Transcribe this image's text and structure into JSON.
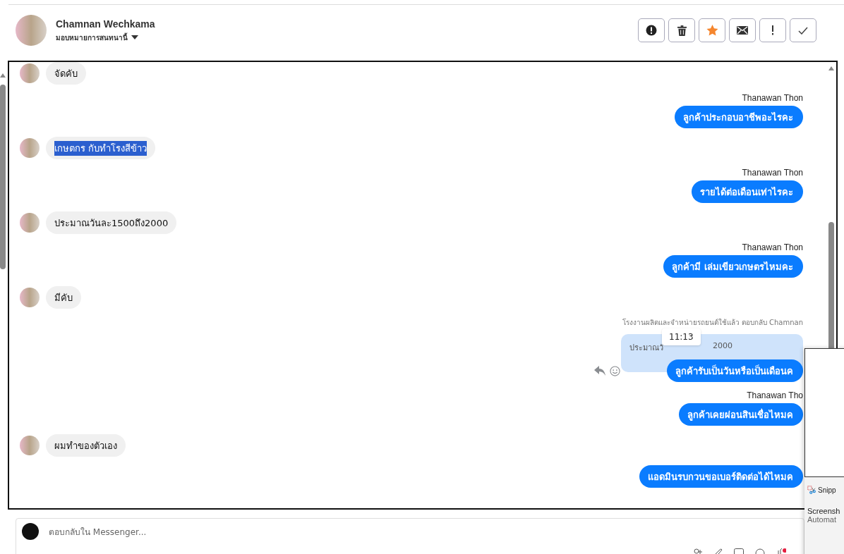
{
  "header": {
    "name": "Chamnan Wechkama",
    "subtitle": "มอบหมายการสนทนานี้",
    "actions": [
      {
        "kind": "alert",
        "active": false
      },
      {
        "kind": "trash",
        "active": false
      },
      {
        "kind": "star",
        "active": true
      },
      {
        "kind": "mail",
        "active": false
      },
      {
        "kind": "exclaim",
        "active": false
      },
      {
        "kind": "check",
        "active": false
      }
    ]
  },
  "messages": [
    {
      "kind": "incoming",
      "text": "จัดคับ",
      "text_selected": false
    },
    {
      "kind": "outgoing",
      "sender": "Thanawan Thon",
      "text": "ลูกค้าประกอบอาชีพอะไรคะ"
    },
    {
      "kind": "incoming",
      "text": "เกษตกร  กับทำโรงสีข้าว",
      "text_selected": true
    },
    {
      "kind": "outgoing",
      "sender": "Thanawan Thon",
      "text": "รายได้ต่อเดือนเท่าไรคะ"
    },
    {
      "kind": "incoming",
      "text": "ประมาณวันละ1500ถึง2000",
      "text_selected": false
    },
    {
      "kind": "outgoing",
      "sender": "Thanawan Thon",
      "text": "ลูกค้ามี  เล่มเขียวเกษตรไหมคะ"
    },
    {
      "kind": "incoming",
      "text": "มีคับ",
      "text_selected": false
    },
    {
      "kind": "reply",
      "reply_label": "โรงงานผลิตและจำหน่ายรถยนต์ใช้แล้ว ตอบกลับ Chamnan",
      "quote_start": "ประมาณวั",
      "quote_end": "2000",
      "tooltip": "11:13",
      "text": "ลูกค้ารับเป็นวันหรือเป็นเดือนค"
    },
    {
      "kind": "outgoing",
      "sender": "Thanawan Tho",
      "text": "ลูกค้าเคยผ่อนสินเชื่อไหมค"
    },
    {
      "kind": "incoming",
      "text": "ผมทำของตัวเอง",
      "text_selected": false
    },
    {
      "kind": "outgoing",
      "text": "แอดมินรบกวนขอเบอร์ติดต่อได้ไหมค"
    }
  ],
  "composer": {
    "placeholder": "ตอบกลับใน Messenger..."
  },
  "notification": {
    "app": "Snipp",
    "title": "Screensh",
    "body": "Automat"
  }
}
